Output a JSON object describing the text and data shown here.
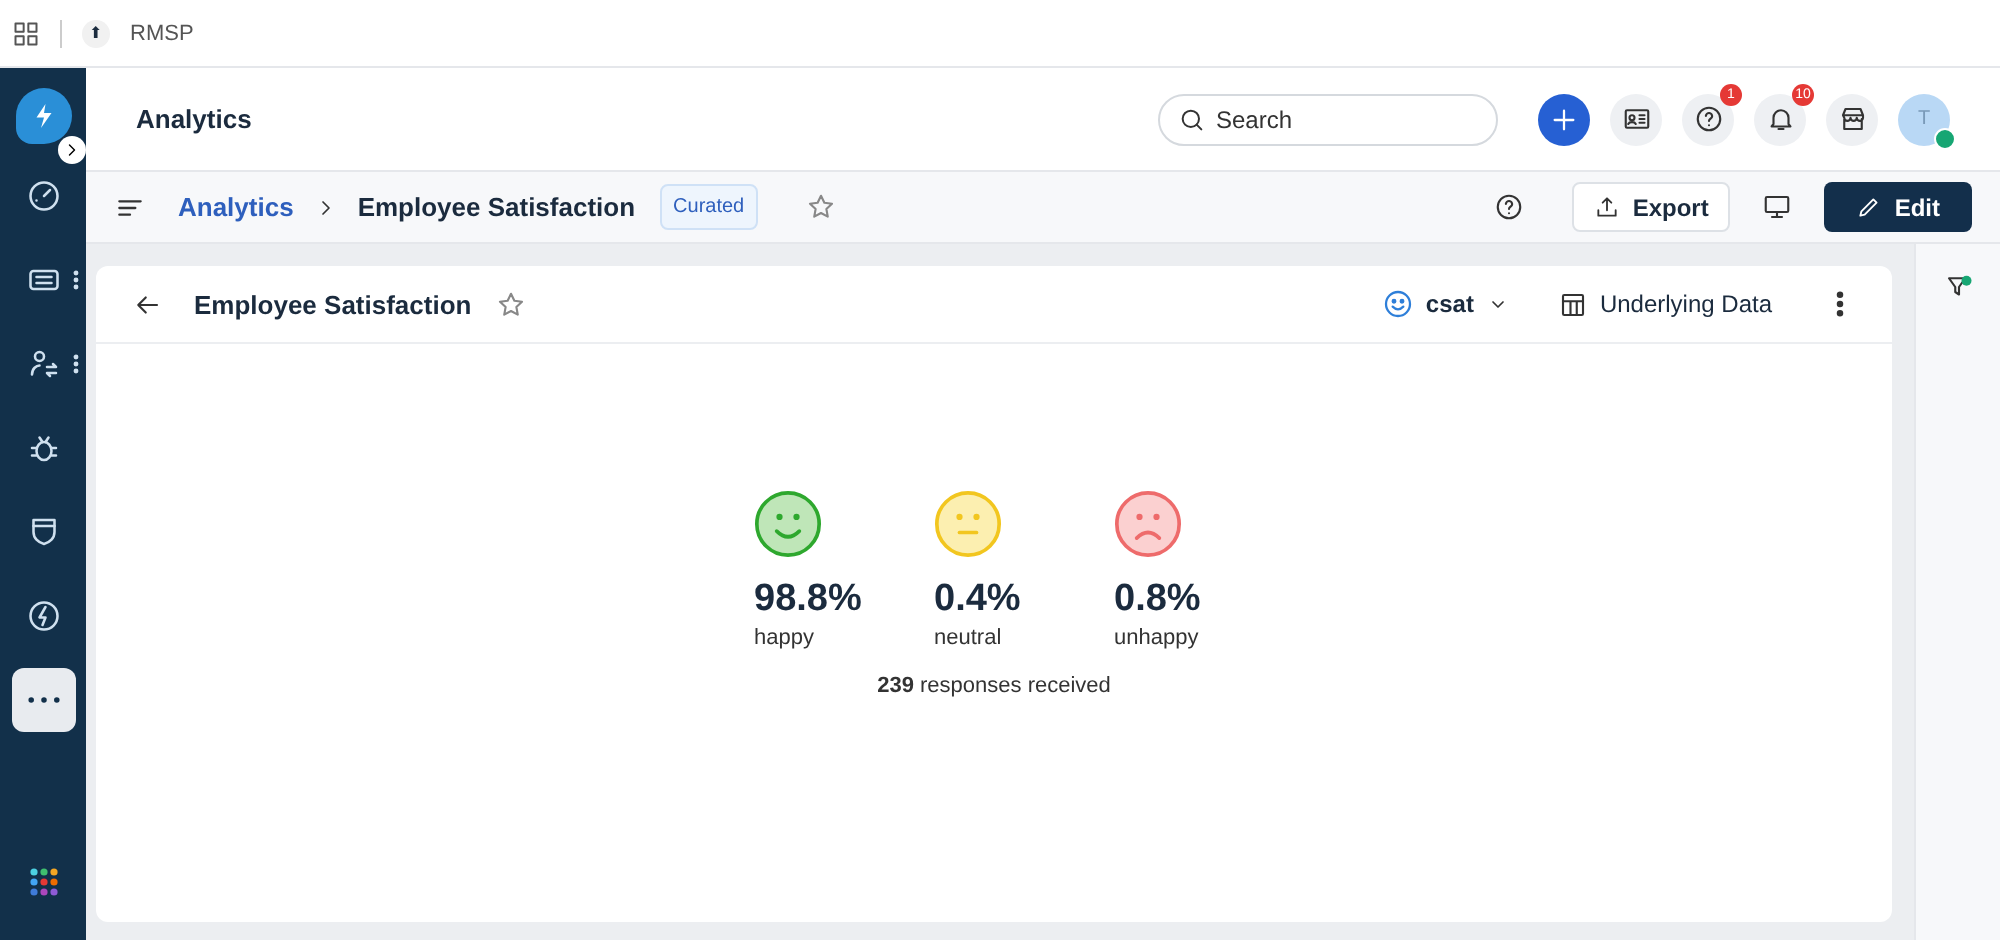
{
  "browser_tab": {
    "favicon": "⬆",
    "title": "RMSP"
  },
  "sidebar": {
    "items": [
      {
        "kind": "gauge",
        "selected": false,
        "menu": false
      },
      {
        "kind": "ticket",
        "selected": false,
        "menu": true
      },
      {
        "kind": "users",
        "selected": false,
        "menu": true
      },
      {
        "kind": "bug",
        "selected": false,
        "menu": false
      },
      {
        "kind": "shield",
        "selected": false,
        "menu": false
      },
      {
        "kind": "bolt",
        "selected": false,
        "menu": false
      },
      {
        "kind": "more",
        "selected": true,
        "menu": false
      }
    ]
  },
  "header": {
    "title": "Analytics",
    "search": {
      "placeholder": "Search"
    },
    "help_badge": "1",
    "notifications_badge": "10",
    "avatar": "T",
    "online": true
  },
  "breadcrumb": {
    "parent": "Analytics",
    "current": "Employee Satisfaction",
    "tag": "Curated",
    "buttons": [
      "Export",
      "Edit"
    ]
  },
  "card": {
    "title": "Employee Satisfaction",
    "metric": "csat",
    "underlying": "Underlying Data",
    "moods": [
      {
        "kind": "happy",
        "color": "#2ea82e",
        "value": "98.8%",
        "label": "happy"
      },
      {
        "kind": "neutral",
        "color": "#f2c61f",
        "value": "0.4%",
        "label": "neutral"
      },
      {
        "kind": "unhappy",
        "color": "#ee6b6b",
        "value": "0.8%",
        "label": "unhappy"
      }
    ],
    "responses": "**239** responses received"
  }
}
